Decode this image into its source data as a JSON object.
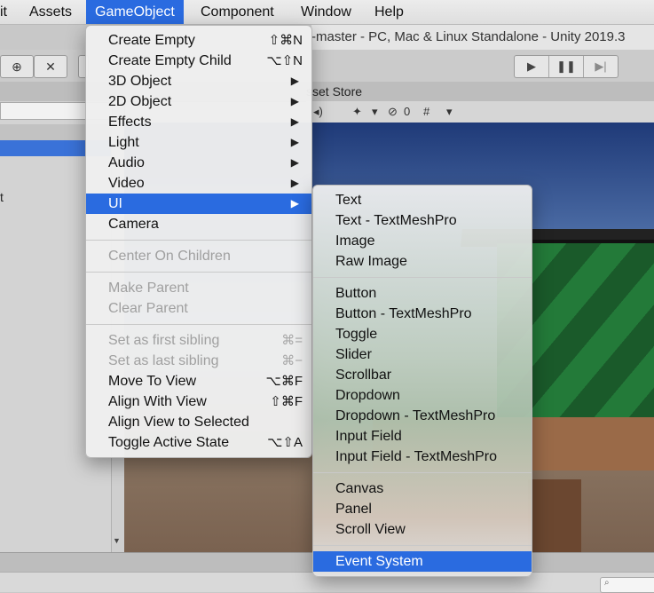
{
  "menubar": {
    "items": [
      {
        "label": "it"
      },
      {
        "label": "Assets"
      },
      {
        "label": "GameObject"
      },
      {
        "label": "Component"
      },
      {
        "label": "Window"
      },
      {
        "label": "Help"
      }
    ]
  },
  "window": {
    "title": "-master - PC, Mac & Linux Standalone - Unity 2019.3",
    "tab_asset_store": "sset Store",
    "scene_toolbar_count": "0",
    "hierarchy_item_fragment": "t"
  },
  "gameobject_menu": {
    "items": [
      {
        "label": "Create Empty",
        "shortcut": "⇧⌘N"
      },
      {
        "label": "Create Empty Child",
        "shortcut": "⌥⇧N"
      },
      {
        "label": "3D Object"
      },
      {
        "label": "2D Object"
      },
      {
        "label": "Effects"
      },
      {
        "label": "Light"
      },
      {
        "label": "Audio"
      },
      {
        "label": "Video"
      },
      {
        "label": "UI"
      },
      {
        "label": "Camera"
      },
      {
        "label": "Center On Children"
      },
      {
        "label": "Make Parent"
      },
      {
        "label": "Clear Parent"
      },
      {
        "label": "Set as first sibling",
        "shortcut": "⌘="
      },
      {
        "label": "Set as last sibling",
        "shortcut": "⌘−"
      },
      {
        "label": "Move To View",
        "shortcut": "⌥⌘F"
      },
      {
        "label": "Align With View",
        "shortcut": "⇧⌘F"
      },
      {
        "label": "Align View to Selected"
      },
      {
        "label": "Toggle Active State",
        "shortcut": "⌥⇧A"
      }
    ]
  },
  "ui_menu": {
    "items": [
      {
        "label": "Text"
      },
      {
        "label": "Text - TextMeshPro"
      },
      {
        "label": "Image"
      },
      {
        "label": "Raw Image"
      },
      {
        "label": "Button"
      },
      {
        "label": "Button - TextMeshPro"
      },
      {
        "label": "Toggle"
      },
      {
        "label": "Slider"
      },
      {
        "label": "Scrollbar"
      },
      {
        "label": "Dropdown"
      },
      {
        "label": "Dropdown - TextMeshPro"
      },
      {
        "label": "Input Field"
      },
      {
        "label": "Input Field - TextMeshPro"
      },
      {
        "label": "Canvas"
      },
      {
        "label": "Panel"
      },
      {
        "label": "Scroll View"
      },
      {
        "label": "Event System"
      }
    ]
  },
  "icons": {
    "submenu_arrow": "▶",
    "play": "▶",
    "pause": "❚❚",
    "step": "▶|"
  }
}
